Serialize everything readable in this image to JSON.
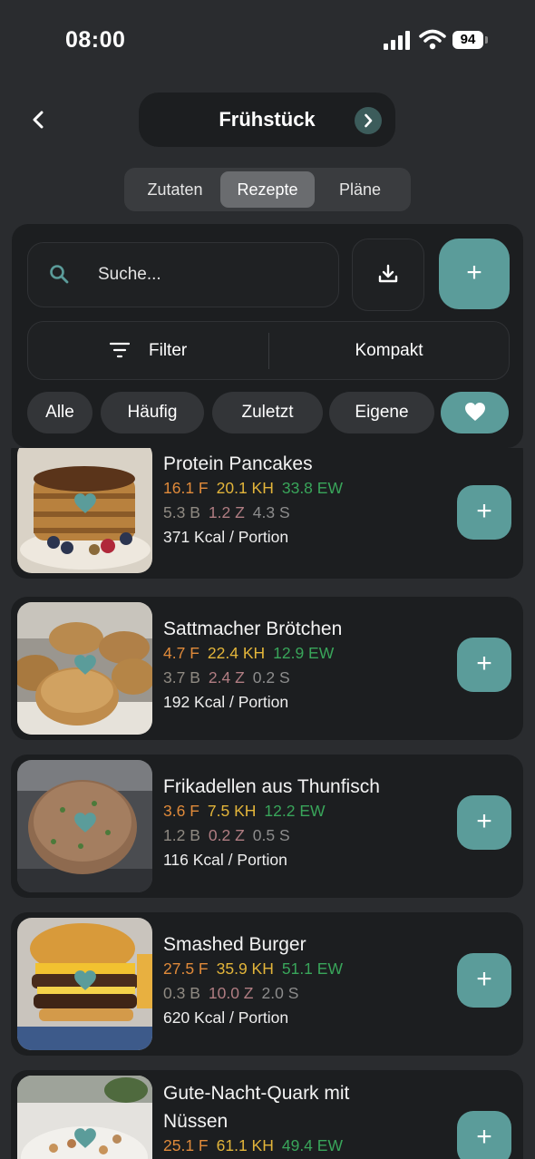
{
  "status": {
    "time": "08:00",
    "battery": "94"
  },
  "header": {
    "title": "Frühstück"
  },
  "tabs": [
    {
      "label": "Zutaten",
      "active": false
    },
    {
      "label": "Rezepte",
      "active": true
    },
    {
      "label": "Pläne",
      "active": false
    }
  ],
  "search": {
    "placeholder": "Suche..."
  },
  "controls": {
    "filter_label": "Filter",
    "compact_label": "Kompakt",
    "add_label": "+"
  },
  "chips": [
    "Alle",
    "Häufig",
    "Zuletzt",
    "Eigene"
  ],
  "recipes": [
    {
      "name": "Protein Pancakes",
      "fat": "16.1 F",
      "carbs": "20.1 KH",
      "protein": "33.8 EW",
      "b": "5.3 B",
      "z": "1.2 Z",
      "s": "4.3 S",
      "kcal": "371 Kcal / Portion",
      "add": "+"
    },
    {
      "name": "Sattmacher Brötchen",
      "fat": "4.7 F",
      "carbs": "22.4 KH",
      "protein": "12.9 EW",
      "b": "3.7 B",
      "z": "2.4 Z",
      "s": "0.2 S",
      "kcal": "192 Kcal / Portion",
      "add": "+"
    },
    {
      "name": "Frikadellen aus Thunfisch",
      "fat": "3.6 F",
      "carbs": "7.5 KH",
      "protein": "12.2 EW",
      "b": "1.2 B",
      "z": "0.2 Z",
      "s": "0.5 S",
      "kcal": "116 Kcal / Portion",
      "add": "+"
    },
    {
      "name": "Smashed Burger",
      "fat": "27.5 F",
      "carbs": "35.9 KH",
      "protein": "51.1 EW",
      "b": "0.3 B",
      "z": "10.0 Z",
      "s": "2.0 S",
      "kcal": "620 Kcal / Portion",
      "add": "+"
    },
    {
      "name": "Gute-Nacht-Quark mit Nüssen",
      "fat": "25.1 F",
      "carbs": "61.1 KH",
      "protein": "49.4 EW",
      "b": "",
      "z": "",
      "s": "",
      "kcal": "",
      "add": "+"
    }
  ],
  "colors": {
    "accent": "#5b9c9a",
    "fat": "#e08a3a",
    "carbs": "#e3b53a",
    "protein": "#39a55a"
  }
}
